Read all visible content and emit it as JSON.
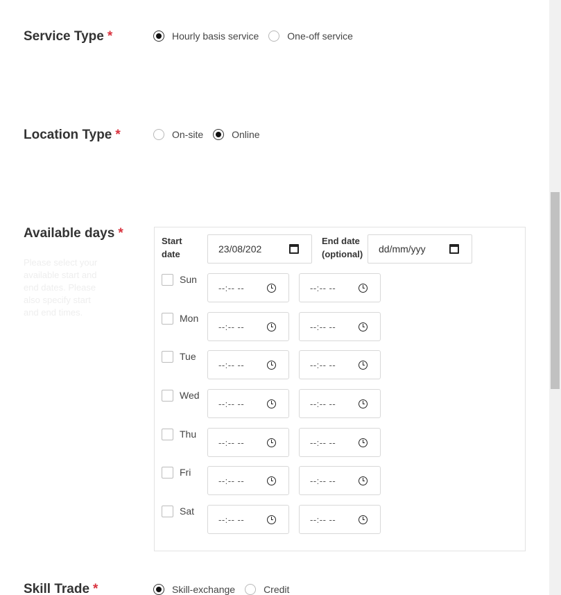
{
  "service_type": {
    "label": "Service Type",
    "required_mark": "*",
    "options": [
      {
        "label": "Hourly basis service",
        "checked": true
      },
      {
        "label": "One-off service",
        "checked": false
      }
    ]
  },
  "location_type": {
    "label": "Location Type",
    "required_mark": "*",
    "options": [
      {
        "label": "On-site",
        "checked": false
      },
      {
        "label": "Online",
        "checked": true
      }
    ]
  },
  "available_days": {
    "label": "Available days",
    "required_mark": "*",
    "help_text": "Please select your available start and end dates. Please also specify start and end times.",
    "start_date_label": "Start date",
    "start_date_value": "23/08/202",
    "end_date_label": "End date (optional)",
    "end_date_placeholder": "dd/mm/yyy",
    "time_placeholder": "--:-- --",
    "days": [
      {
        "label": "Sun",
        "checked": false
      },
      {
        "label": "Mon",
        "checked": false
      },
      {
        "label": "Tue",
        "checked": false
      },
      {
        "label": "Wed",
        "checked": false
      },
      {
        "label": "Thu",
        "checked": false
      },
      {
        "label": "Fri",
        "checked": false
      },
      {
        "label": "Sat",
        "checked": false
      }
    ]
  },
  "skill_trade": {
    "label": "Skill Trade",
    "required_mark": "*",
    "options": [
      {
        "label": "Skill-exchange",
        "checked": true
      },
      {
        "label": "Credit",
        "checked": false
      }
    ]
  },
  "colors": {
    "required": "#d9333f",
    "help_text": "#eeeeee",
    "border": "#d8d8d8"
  },
  "icons": {
    "date": "calendar-icon",
    "time": "clock-icon"
  }
}
